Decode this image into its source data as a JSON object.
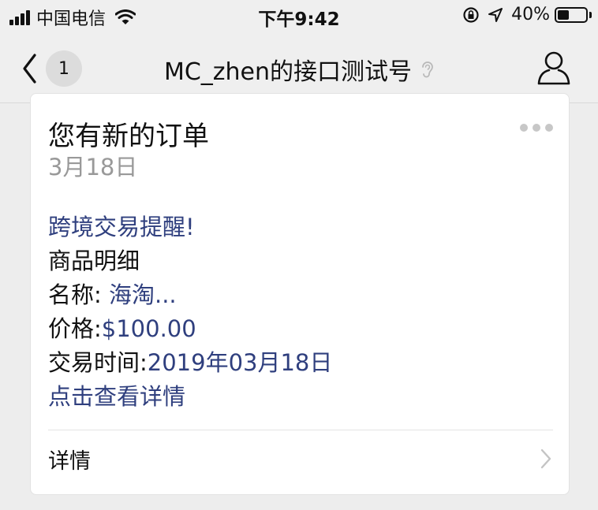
{
  "status_bar": {
    "carrier": "中国电信",
    "time": "下午9:42",
    "battery_percent": "40%",
    "battery_level": 0.4,
    "icons": [
      "signal-icon",
      "wifi-icon",
      "rotation-lock-icon",
      "location-icon",
      "battery-icon"
    ]
  },
  "nav": {
    "back_count": "1",
    "title": "MC_zhen的接口测试号",
    "icons": [
      "back-chevron-icon",
      "ear-icon",
      "profile-icon"
    ]
  },
  "message": {
    "title": "您有新的订单",
    "date": "3月18日",
    "alert": "跨境交易提醒!",
    "section": "商品明细",
    "name_label": "名称: ",
    "name_value": "海淘...",
    "price_label": "价格:",
    "price_value": "$100.00",
    "time_label": "交易时间:",
    "time_value": "2019年03月18日",
    "view_link": "点击查看详情",
    "detail_label": "详情"
  },
  "colors": {
    "background": "#ededed",
    "link_blue": "#2f3f7e",
    "date_gray": "#999999"
  }
}
